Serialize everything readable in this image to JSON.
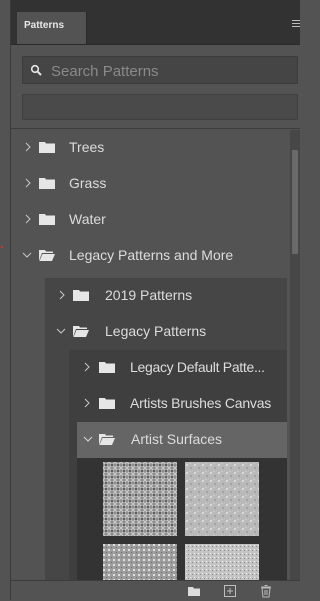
{
  "panel": {
    "tab_label": "Patterns",
    "search_placeholder": "Search Patterns"
  },
  "tree": [
    {
      "label": "Trees",
      "level": 0,
      "expanded": false
    },
    {
      "label": "Grass",
      "level": 0,
      "expanded": false
    },
    {
      "label": "Water",
      "level": 0,
      "expanded": false
    },
    {
      "label": "Legacy Patterns and More",
      "level": 0,
      "expanded": true
    },
    {
      "label": "2019 Patterns",
      "level": 1,
      "expanded": false
    },
    {
      "label": "Legacy Patterns",
      "level": 1,
      "expanded": true
    },
    {
      "label": "Legacy Default Patte...",
      "level": 2,
      "expanded": false
    },
    {
      "label": "Artists Brushes Canvas",
      "level": 2,
      "expanded": false
    },
    {
      "label": "Artist Surfaces",
      "level": 2,
      "expanded": true,
      "selected": true
    }
  ],
  "icons": {
    "search": "search-icon",
    "folder": "folder-icon",
    "chevron_right": "chevron-right-icon",
    "chevron_down": "chevron-down-icon",
    "new_group": "new-group-icon",
    "new_pattern": "new-pattern-icon",
    "delete": "trash-icon",
    "menu": "panel-menu-icon"
  },
  "colors": {
    "panel_bg": "#535353",
    "header_bg": "#323232",
    "selected_row": "#656565",
    "text": "#dcdcdc"
  }
}
